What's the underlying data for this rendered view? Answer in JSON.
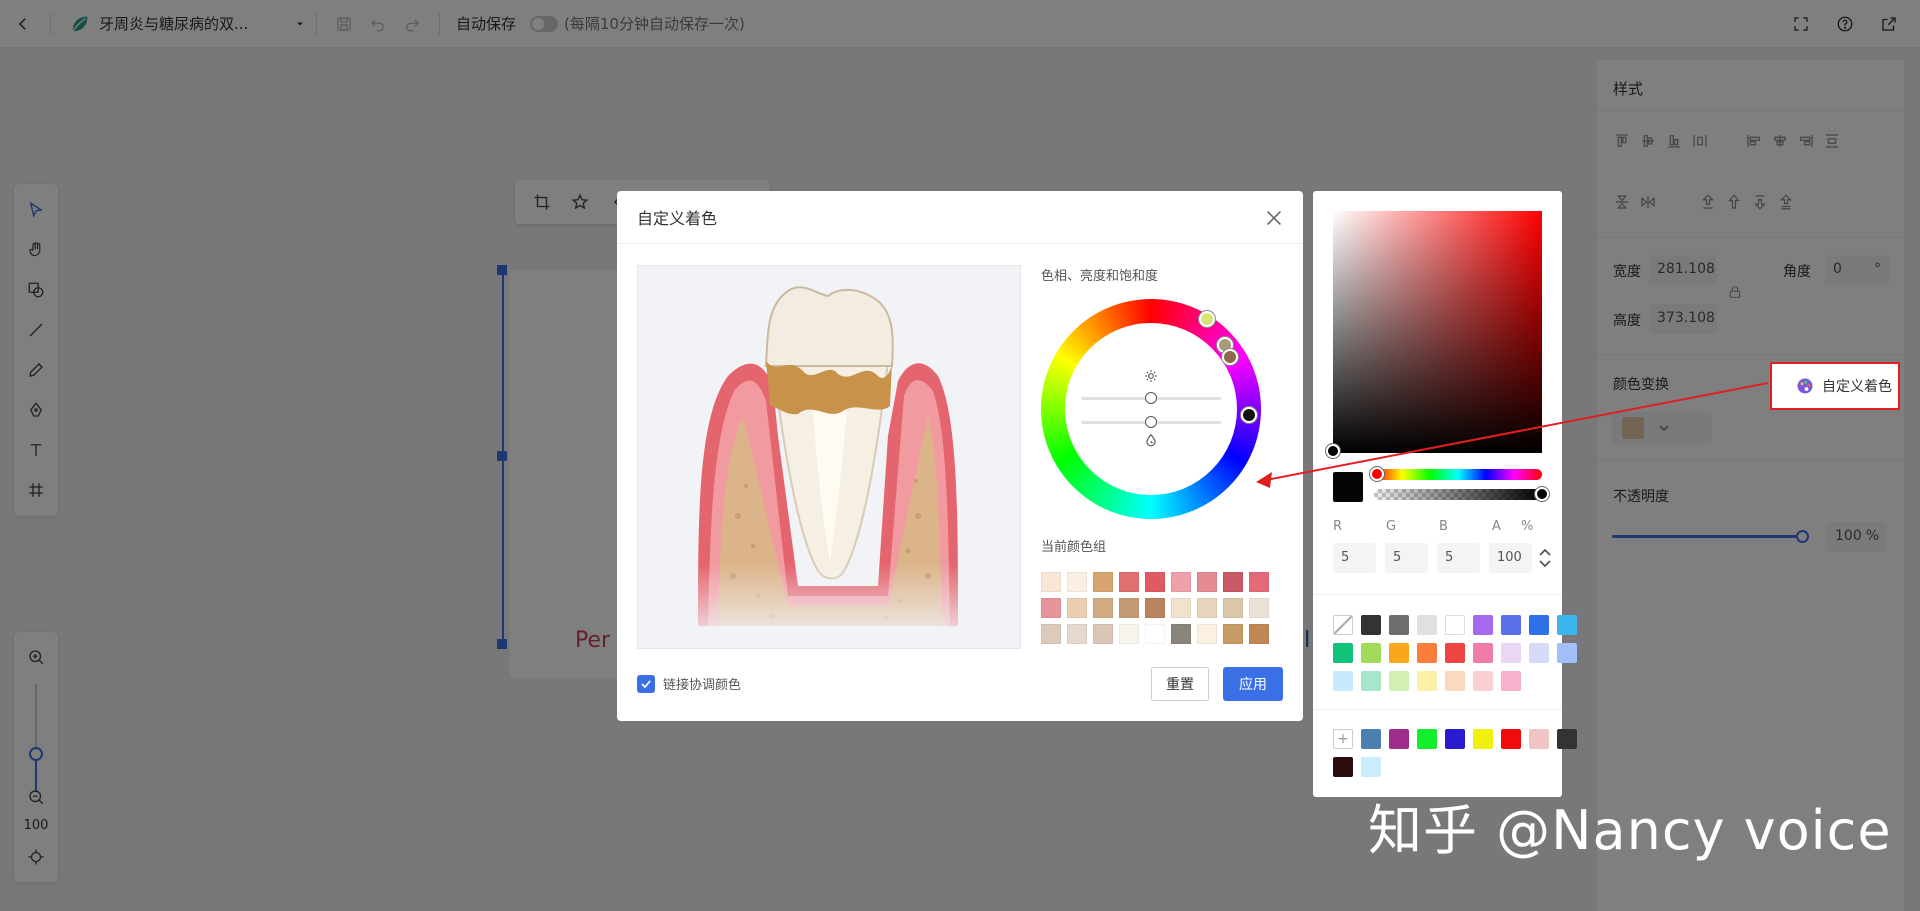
{
  "topbar": {
    "doc_title": "牙周炎与糖尿病的双...",
    "autosave_label": "自动保存",
    "autosave_hint": "(每隔10分钟自动保存一次)"
  },
  "zoom": {
    "value": "100"
  },
  "canvas": {
    "text_left": "Per",
    "text_right": "ll"
  },
  "right_panel": {
    "title": "样式",
    "width_label": "宽度",
    "width_value": "281.108",
    "height_label": "高度",
    "height_value": "373.108",
    "angle_label": "角度",
    "angle_value": "0",
    "angle_unit": "°",
    "color_transform_label": "颜色变换",
    "custom_color_label": "自定义着色",
    "opacity_label": "不透明度",
    "opacity_value": "100",
    "opacity_unit": "%",
    "opacity_level": 1.0
  },
  "modal": {
    "title": "自定义着色",
    "hsb_label": "色相、亮度和饱和度",
    "palette_label": "当前颜色组",
    "link_label": "链接协调颜色",
    "link_checked": true,
    "reset_label": "重置",
    "apply_label": "应用",
    "palette": [
      "#f8e6d6",
      "#fbeee2",
      "#d7a46f",
      "#e07070",
      "#e05a64",
      "#f0a0aa",
      "#e68a94",
      "#c75a66",
      "#e36a78",
      "#e8949c",
      "#ead0b0",
      "#d2aa82",
      "#c49a76",
      "#b8845e",
      "#f0e2cc",
      "#e8d4bc",
      "#dcc6aa",
      "#ece2d4",
      "#dccabc",
      "#e6d8cc",
      "#dcc6b8",
      "#f8f4ee",
      "#ffffff",
      "#8a847c",
      "#fbf0e2",
      "#c79a66",
      "#c08654"
    ]
  },
  "picker": {
    "labels": {
      "r": "R",
      "g": "G",
      "b": "B",
      "a": "A",
      "pct": "%"
    },
    "values": {
      "r": "5",
      "g": "5",
      "b": "5",
      "a": "100"
    },
    "current_color": "#050505",
    "swatches": [
      "none",
      "#333333",
      "#6e6e6e",
      "#e0e0e0",
      "#ffffff",
      "#a66af0",
      "#5a6fea",
      "#2f6fe8",
      "#3bb4f0",
      "#13c27a",
      "#a2db5a",
      "#f7a81b",
      "#fa7d3c",
      "#ef4444",
      "#f07aa8",
      "#ecd6f6",
      "#d6dcf8",
      "#a2c0f8",
      "#c8e9fb",
      "#a6e6cc",
      "#d2f0b4",
      "#fdf0a8",
      "#fcd8bc",
      "#fbd0d4",
      "#f9b0cc"
    ],
    "recent": [
      "add",
      "#4a7fb0",
      "#a02c8c",
      "#13ee2c",
      "#2a1bd0",
      "#f0f00c",
      "#f00c0c",
      "#f0c4c4",
      "#333333",
      "#2c0c0c",
      "#c8eefc"
    ]
  },
  "watermark": "知乎 @Nancy voice"
}
